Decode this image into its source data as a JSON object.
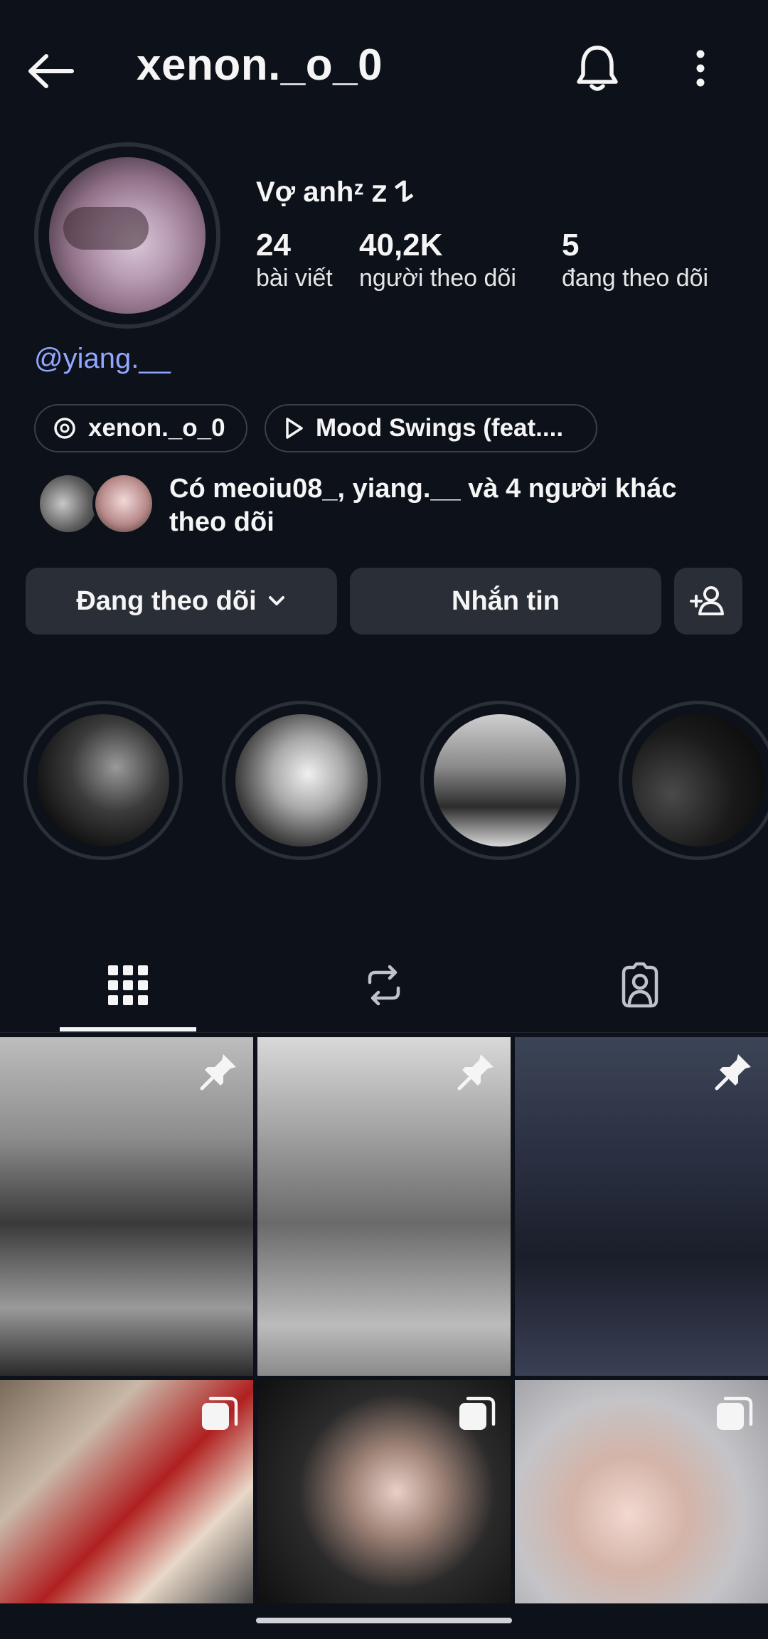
{
  "header": {
    "title": "xenon._o_0",
    "back_icon": "arrow-left-icon",
    "bell_icon": "bell-icon",
    "more_icon": "more-vertical-icon"
  },
  "profile": {
    "display_name": "Vợ anhᶻ 𝗓 𐰁",
    "stats": [
      {
        "value": "24",
        "label": "bài viết"
      },
      {
        "value": "40,2K",
        "label": "người theo dõi"
      },
      {
        "value": "5",
        "label": "đang theo dõi"
      }
    ],
    "threads_link": "@yiang.__"
  },
  "pills": [
    {
      "icon": "threads-icon",
      "label": "xenon._o_0"
    },
    {
      "icon": "play-icon",
      "label": "Mood Swings (feat...."
    }
  ],
  "mutual": {
    "text": "Có meoiu08_, yiang.__ và 4 người khác theo dõi"
  },
  "actions": {
    "following_label": "Đang theo dõi",
    "message_label": "Nhắn tin",
    "add_user_icon": "add-user-icon"
  },
  "tabs": [
    {
      "name": "grid",
      "icon": "grid-icon",
      "active": true
    },
    {
      "name": "reposts",
      "icon": "repost-icon",
      "active": false
    },
    {
      "name": "tagged",
      "icon": "tagged-icon",
      "active": false
    }
  ],
  "posts": [
    {
      "badge": "pin-icon"
    },
    {
      "badge": "pin-icon"
    },
    {
      "badge": "pin-icon"
    },
    {
      "badge": "carousel-icon"
    },
    {
      "badge": "carousel-icon"
    },
    {
      "badge": "carousel-icon"
    }
  ],
  "colors": {
    "background": "#0c111a",
    "button": "#2a2f37",
    "link": "#93a6ff"
  }
}
